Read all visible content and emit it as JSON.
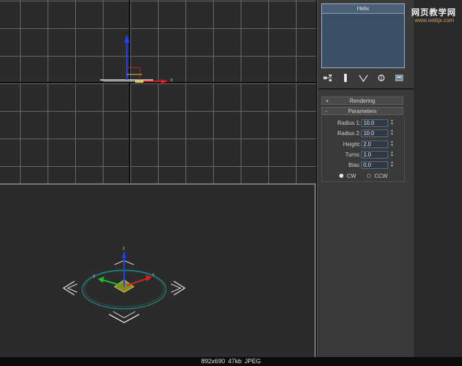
{
  "watermark": {
    "site_name": "网页教学网",
    "url": "www.webjx.com"
  },
  "viewports": {
    "top": {
      "axis_x_label": "x"
    },
    "perspective": {
      "gizmo_labels": {
        "x": "x",
        "y": "y",
        "z": "z"
      }
    }
  },
  "command_panel": {
    "preview_title": "Helix",
    "toolbar_icons": [
      "hierarchy-icon",
      "motion-icon",
      "display-icon",
      "utilities-icon",
      "configure-icon"
    ],
    "rollouts": {
      "rendering": {
        "sign": "+",
        "label": "Rendering"
      },
      "parameters": {
        "sign": "-",
        "label": "Parameters"
      }
    },
    "parameters": [
      {
        "label": "Radius 1:",
        "value": "10.0"
      },
      {
        "label": "Radius 2:",
        "value": "10.0"
      },
      {
        "label": "Height:",
        "value": "2.0"
      },
      {
        "label": "Turns:",
        "value": "1.0"
      },
      {
        "label": "Bias:",
        "value": "0.0"
      }
    ],
    "direction": {
      "options": [
        "CW",
        "CCW"
      ],
      "selected": "CW"
    }
  },
  "footer": {
    "info": "892x690  47kb  JPEG"
  },
  "colors": {
    "viewport_bg": "#2b2b2b",
    "grid_line": "#6b6b6b",
    "panel_bg": "#3a3a3a",
    "preview_bg": "#3b5066",
    "field_bg": "#2f3a46",
    "axis_x": "#e02020",
    "axis_y": "#20c020",
    "axis_z": "#2040ff",
    "helix_ring": "#2a8a8a"
  }
}
